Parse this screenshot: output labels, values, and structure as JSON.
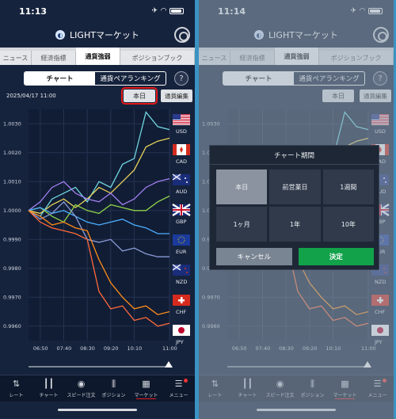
{
  "screens": [
    {
      "time": "11:13",
      "app_title": "LIGHTマーケット",
      "tabs": [
        "ニュース",
        "経済指標",
        "通貨強弱",
        "ポジションブック"
      ],
      "active_tab": 2,
      "segment": [
        "チャート",
        "通貨ペアランキング"
      ],
      "help": "?",
      "date": "2025/04/17 11:00",
      "period_button": "本日",
      "edit_button": "通貨編集",
      "nav": [
        "レート",
        "チャート",
        "スピード注文",
        "ポジション",
        "マーケット",
        "メニュー"
      ]
    },
    {
      "time": "11:14",
      "app_title": "LIGHTマーケット",
      "tabs": [
        "ニュース",
        "経済指標",
        "通貨強弱",
        "ポジションブック"
      ],
      "active_tab": 2,
      "segment": [
        "チャート",
        "通貨ペアランキング"
      ],
      "help": "?",
      "period_button": "本日",
      "edit_button": "通貨編集",
      "nav": [
        "レート",
        "チャート",
        "スピード注文",
        "ポジション",
        "マーケット",
        "メニュー"
      ],
      "modal": {
        "title": "チャート期間",
        "options": [
          "本日",
          "前営業日",
          "1週間",
          "1ヶ月",
          "1年",
          "10年"
        ],
        "selected": "本日",
        "cancel": "キャンセル",
        "confirm": "決定"
      }
    }
  ],
  "colors": {
    "USD": "#6fd6e0",
    "CAD": "#e8d25a",
    "AUD": "#a37ff0",
    "GBP": "#8fd148",
    "EUR": "#4db0ff",
    "NZD": "#8a9bd6",
    "CHF": "#ff6a3a",
    "JPY": "#ff8c1a"
  },
  "chart_data": {
    "type": "line",
    "x": [
      "06:30",
      "06:50",
      "07:10",
      "07:40",
      "08:10",
      "08:30",
      "08:50",
      "09:20",
      "09:40",
      "10:10",
      "10:30",
      "10:50",
      "11:00"
    ],
    "x_ticks": [
      "06:50",
      "07:40",
      "08:30",
      "09:20",
      "10:10",
      "11:00"
    ],
    "y_ticks": [
      "1.0030",
      "1.0020",
      "1.0010",
      "1.0000",
      "0.9990",
      "0.9980",
      "0.9970",
      "0.9960"
    ],
    "ylim": [
      0.9955,
      1.0035
    ],
    "series": [
      {
        "name": "USD",
        "values": [
          1.0,
          0.9998,
          1.0004,
          1.0006,
          1.0008,
          1.0003,
          1.001,
          1.0008,
          1.0016,
          1.0018,
          1.0034,
          1.0029,
          1.0028
        ]
      },
      {
        "name": "CAD",
        "values": [
          1.0,
          0.9999,
          1.0002,
          1.0004,
          1.0001,
          1.0004,
          1.0008,
          1.0006,
          1.001,
          1.0014,
          1.0022,
          1.0024,
          1.0025
        ]
      },
      {
        "name": "AUD",
        "values": [
          1.0,
          1.0003,
          1.0008,
          1.001,
          1.0006,
          1.0004,
          1.0003,
          1.0006,
          1.0002,
          1.0004,
          1.0008,
          1.001,
          1.0011
        ]
      },
      {
        "name": "GBP",
        "values": [
          1.0,
          1.0001,
          0.9998,
          0.9996,
          1.0002,
          1.0,
          0.9999,
          1.0002,
          1.0001,
          1.0,
          1.0,
          1.0003,
          1.0005
        ]
      },
      {
        "name": "EUR",
        "values": [
          1.0,
          1.0001,
          0.9999,
          1.0,
          0.9998,
          0.9996,
          0.9995,
          0.9996,
          0.9997,
          0.9995,
          0.9994,
          0.9992,
          0.9992
        ]
      },
      {
        "name": "NZD",
        "values": [
          1.0,
          0.9997,
          0.9999,
          1.0003,
          0.9998,
          0.999,
          0.9989,
          0.999,
          0.9986,
          0.9987,
          0.9985,
          0.9984,
          0.9984
        ]
      },
      {
        "name": "CHF",
        "values": [
          1.0,
          0.9996,
          0.9994,
          0.9993,
          0.9992,
          0.999,
          0.9972,
          0.9966,
          0.9967,
          0.9962,
          0.9963,
          0.996,
          0.9961
        ]
      },
      {
        "name": "JPY",
        "values": [
          1.0,
          0.9998,
          0.9995,
          0.9996,
          0.9994,
          0.9993,
          0.9983,
          0.9975,
          0.997,
          0.9966,
          0.9967,
          0.9964,
          0.9965
        ]
      }
    ]
  }
}
